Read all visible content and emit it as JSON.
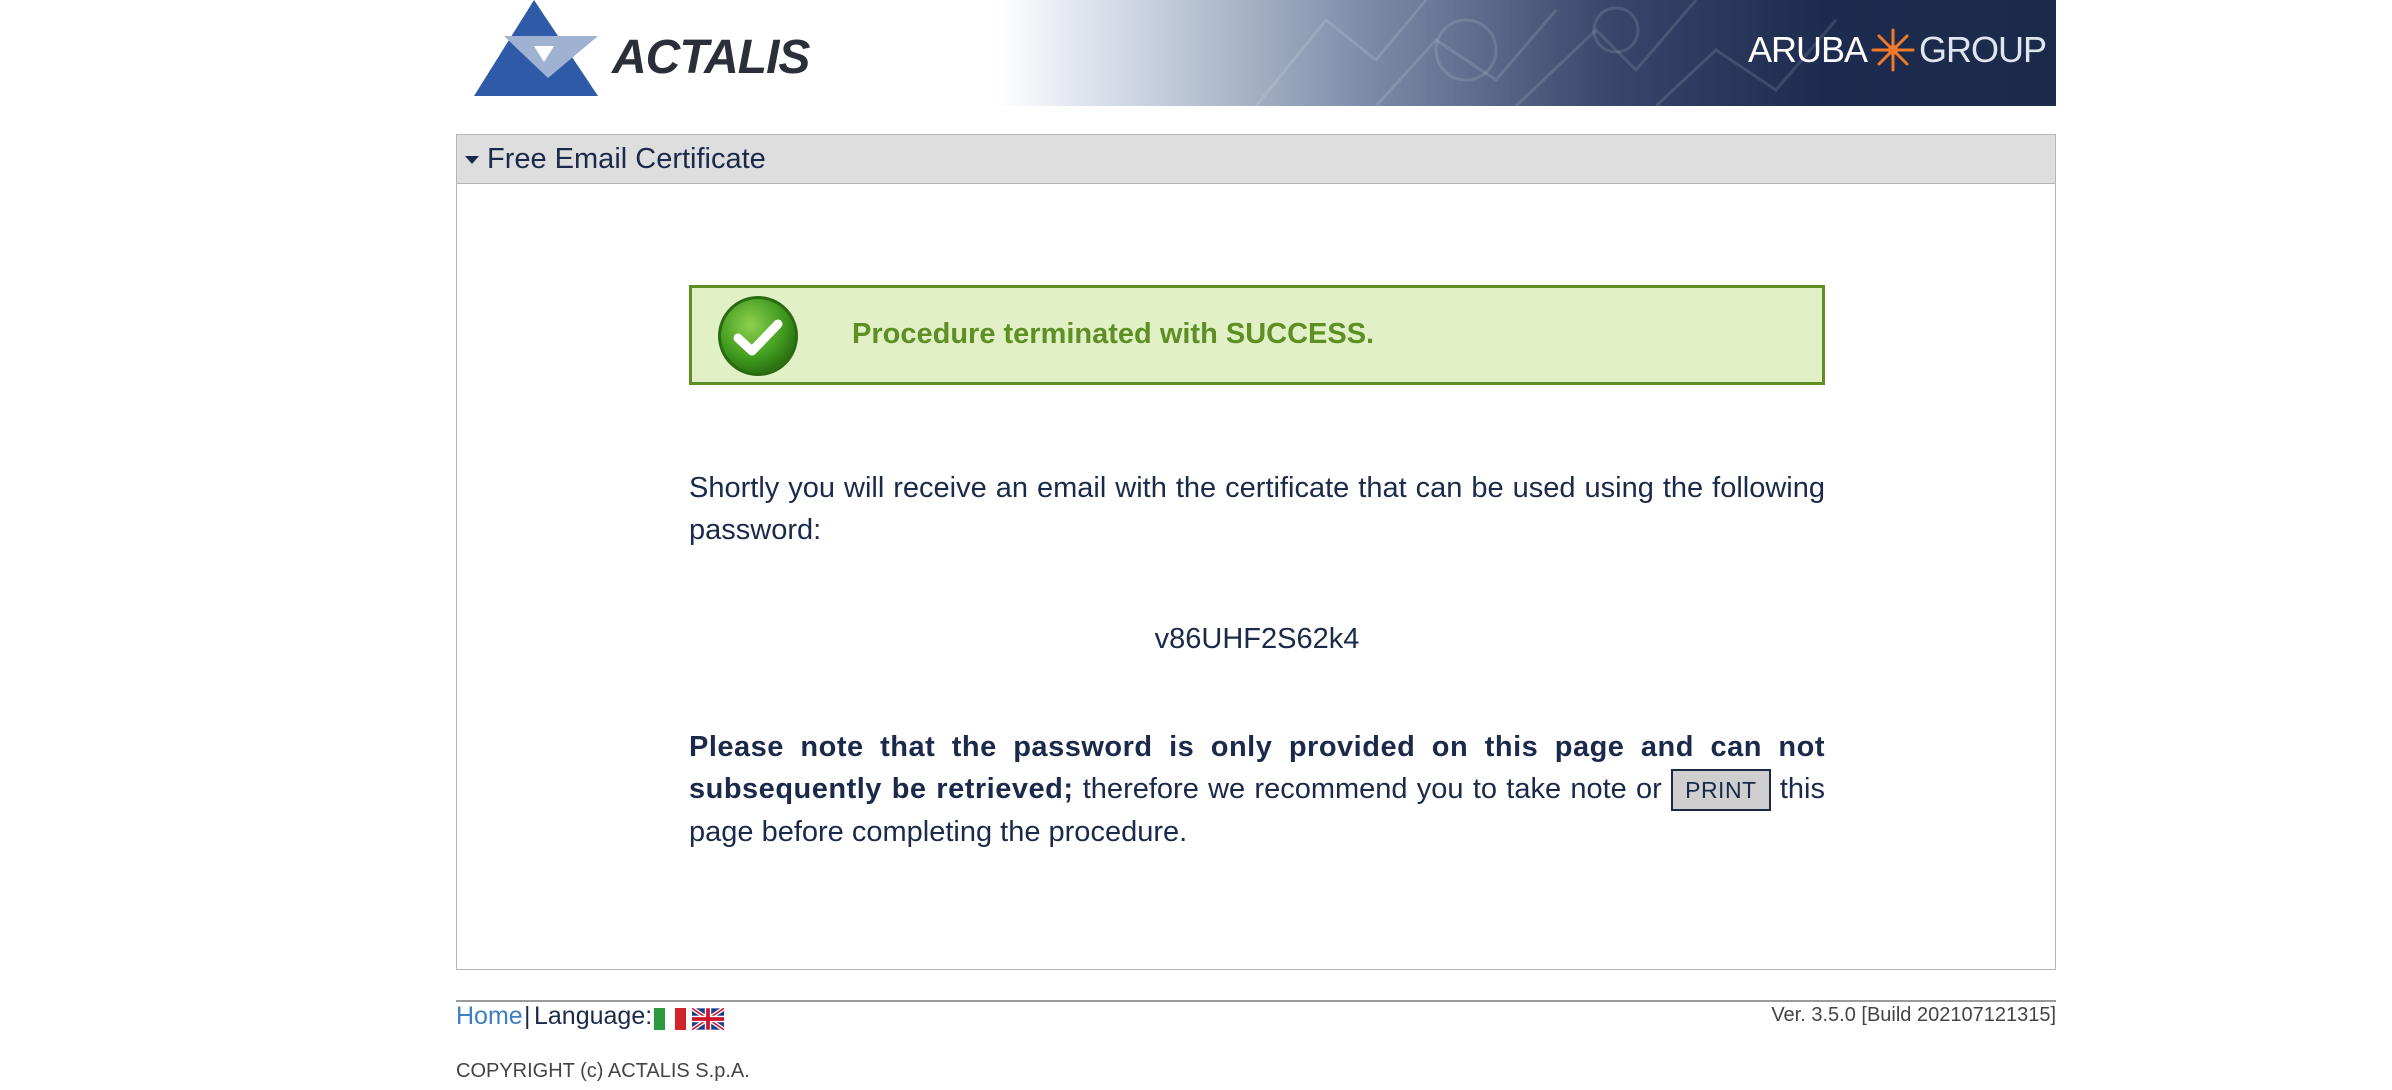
{
  "header": {
    "logo_text": "ACTALIS",
    "group_brand_left": "ARUBA",
    "group_brand_right": "GROUP"
  },
  "panel": {
    "title": "Free Email Certificate",
    "toggle_icon": "caret-down-icon"
  },
  "success": {
    "icon": "check-circle-icon",
    "message": "Procedure terminated with SUCCESS.",
    "colors": {
      "background": "#e1f0c6",
      "border": "#5d8f22",
      "text": "#5d8f22"
    }
  },
  "message": {
    "intro": "Shortly you will receive an email with the certificate that can be used using the following password:",
    "password": "v86UHF2S62k4",
    "note_bold": "Please note that the password is only provided on this page and can not subsequently be retrieved;",
    "note_mid": " therefore we recommend you to take note or ",
    "print_label": "PRINT",
    "note_end": " this page before completing the procedure."
  },
  "footer": {
    "home_link": "Home",
    "separator": "|",
    "language_label": "Language:",
    "languages": [
      "italian-flag-icon",
      "uk-flag-icon"
    ],
    "version": "Ver. 3.5.0 [Build 202107121315]",
    "copyright": "COPYRIGHT (c) ACTALIS S.p.A."
  },
  "colors": {
    "text": "#1b2a4a",
    "link": "#3d7fc1",
    "panel_header_bg": "#dedede"
  }
}
